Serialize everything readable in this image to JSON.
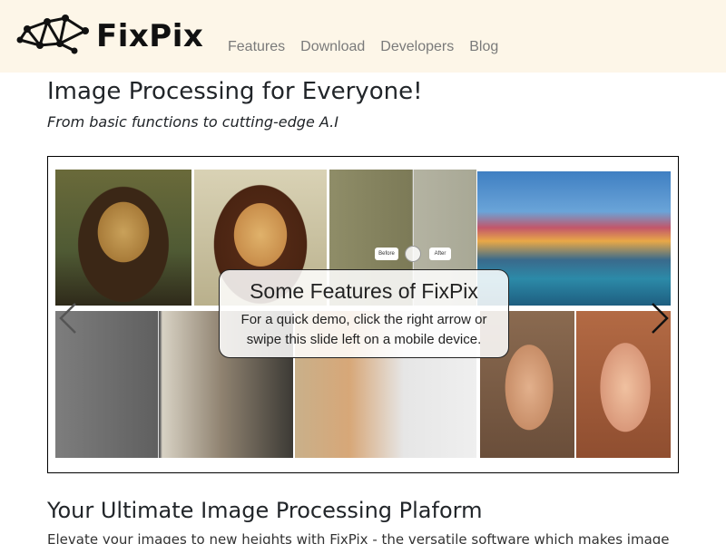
{
  "header": {
    "brand": "FixPix",
    "nav": [
      "Features",
      "Download",
      "Developers",
      "Blog"
    ],
    "background": "#fdf6e8"
  },
  "hero": {
    "title": "Image Processing for Everyone!",
    "tagline": "From basic functions to cutting-edge A.I"
  },
  "carousel": {
    "caption_title": "Some Features of FixPix",
    "caption_text": "For a quick demo, click the right arrow or swipe this slide left on a mobile device.",
    "prev_icon": "chevron-left-icon",
    "next_icon": "chevron-right-icon",
    "compare_labels": [
      "Before",
      "After"
    ]
  },
  "section": {
    "title": "Your Ultimate Image Processing Plaform",
    "text": "Elevate your images to new heights with FixPix - the versatile software which makes image"
  }
}
